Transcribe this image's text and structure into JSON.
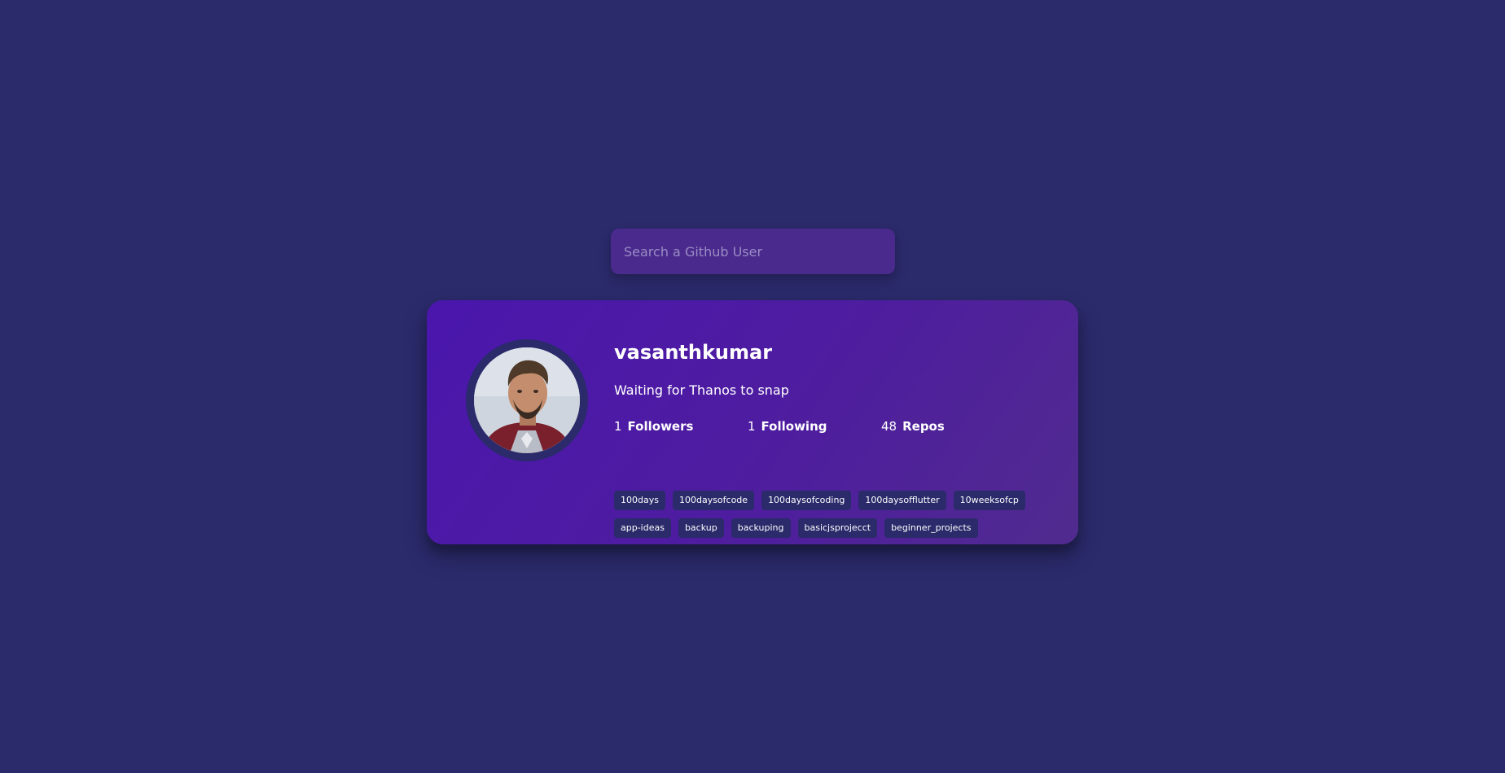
{
  "search": {
    "placeholder": "Search a Github User",
    "value": ""
  },
  "profile": {
    "username": "vasanthkumar",
    "bio": "Waiting for Thanos to snap",
    "avatar_alt": "avatar",
    "stats": {
      "followers": {
        "count": "1",
        "label": "Followers"
      },
      "following": {
        "count": "1",
        "label": "Following"
      },
      "repos": {
        "count": "48",
        "label": "Repos"
      }
    },
    "topics": [
      "100days",
      "100daysofcode",
      "100daysofcoding",
      "100daysofflutter",
      "10weeksofcp",
      "app-ideas",
      "backup",
      "backuping",
      "basicjsprojecct",
      "beginner_projects"
    ]
  },
  "colors": {
    "background": "#2b2a6b",
    "search_bg": "#4a2a8c",
    "card_gradient_start": "#4a16ad",
    "card_gradient_end": "#512b8f",
    "topic_bg": "#2b2a6b",
    "text": "#ffffff",
    "placeholder": "#9a8cc4"
  }
}
